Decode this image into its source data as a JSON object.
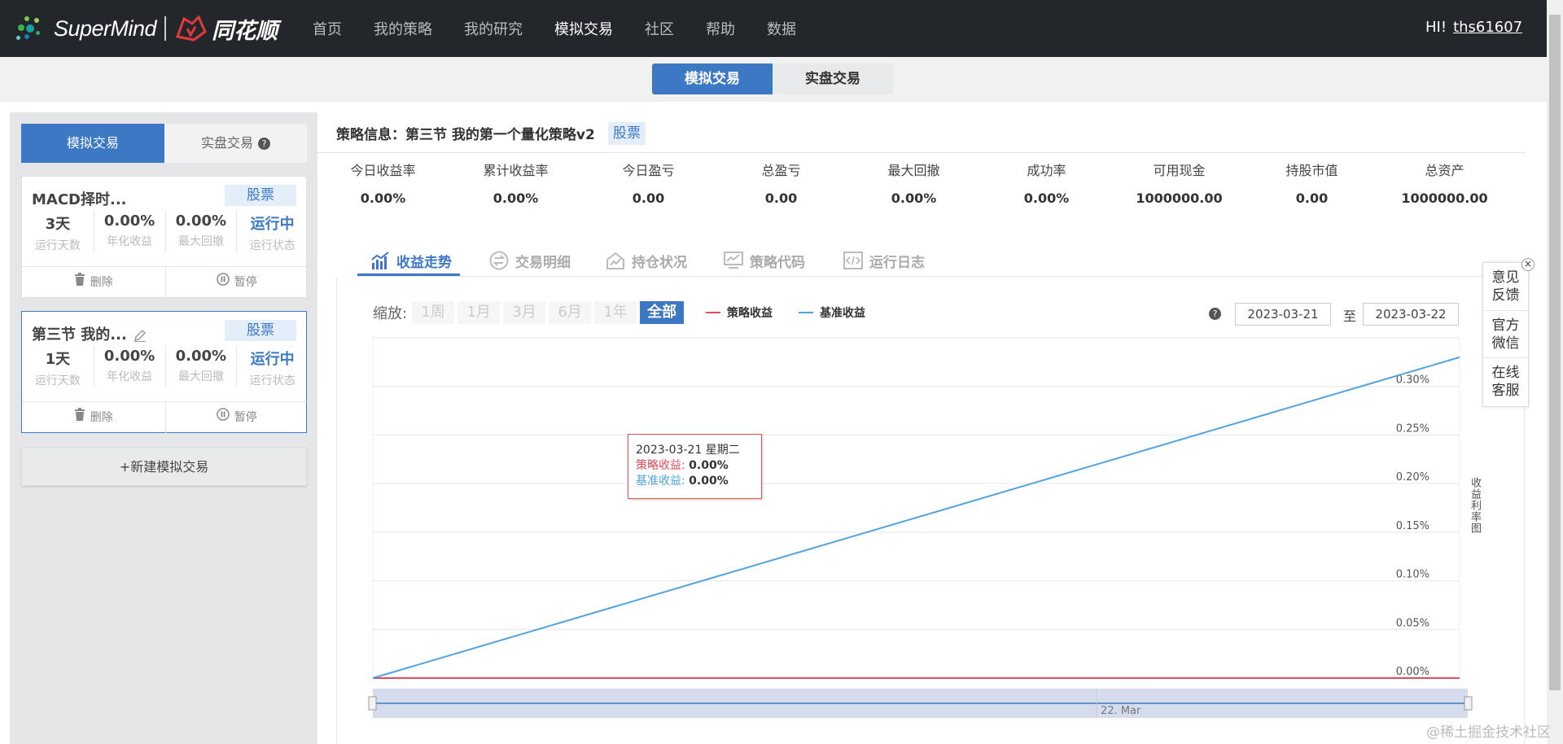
{
  "brand": {
    "supermind": "SuperMind",
    "ths": "同花顺"
  },
  "nav": {
    "items": [
      "首页",
      "我的策略",
      "我的研究",
      "模拟交易",
      "社区",
      "帮助",
      "数据"
    ],
    "active_index": 3,
    "greeting": "HI!",
    "username": "ths61607"
  },
  "subtabs": {
    "sim": "模拟交易",
    "real": "实盘交易"
  },
  "left": {
    "tab_sim": "模拟交易",
    "tab_real": "实盘交易",
    "help": "?",
    "cards": [
      {
        "title": "MACD择时...",
        "tag": "股票",
        "stats": [
          {
            "value": "3天",
            "label": "运行天数"
          },
          {
            "value": "0.00%",
            "label": "年化收益"
          },
          {
            "value": "0.00%",
            "label": "最大回撤"
          },
          {
            "value": "运行中",
            "label": "运行状态"
          }
        ],
        "delete": "删除",
        "pause": "暂停"
      },
      {
        "title": "第三节 我的...",
        "tag": "股票",
        "stats": [
          {
            "value": "1天",
            "label": "运行天数"
          },
          {
            "value": "0.00%",
            "label": "年化收益"
          },
          {
            "value": "0.00%",
            "label": "最大回撤"
          },
          {
            "value": "运行中",
            "label": "运行状态"
          }
        ],
        "delete": "删除",
        "pause": "暂停"
      }
    ],
    "new_button": "+新建模拟交易"
  },
  "strategy": {
    "title": "策略信息：第三节 我的第一个量化策略v2",
    "tag": "股票",
    "metrics": [
      {
        "label": "今日收益率",
        "value": "0.00%"
      },
      {
        "label": "累计收益率",
        "value": "0.00%"
      },
      {
        "label": "今日盈亏",
        "value": "0.00"
      },
      {
        "label": "总盈亏",
        "value": "0.00"
      },
      {
        "label": "最大回撤",
        "value": "0.00%"
      },
      {
        "label": "成功率",
        "value": "0.00%"
      },
      {
        "label": "可用现金",
        "value": "1000000.00"
      },
      {
        "label": "持股市值",
        "value": "0.00"
      },
      {
        "label": "总资产",
        "value": "1000000.00"
      }
    ]
  },
  "tabs": [
    "收益走势",
    "交易明细",
    "持仓状况",
    "策略代码",
    "运行日志"
  ],
  "controls": {
    "zoom_label": "缩放:",
    "zoom_options": [
      "1周",
      "1月",
      "3月",
      "6月",
      "1年",
      "全部"
    ],
    "zoom_selected": "全部",
    "legend_strategy": "策略收益",
    "legend_benchmark": "基准收益",
    "date_from": "2023-03-21",
    "date_sep": "至",
    "date_to": "2023-03-22",
    "help": "?"
  },
  "tooltip": {
    "date": "2023-03-21 星期二",
    "strategy_label": "策略收益:",
    "strategy_value": "0.00%",
    "benchmark_label": "基准收益:",
    "benchmark_value": "0.00%"
  },
  "chart_data": {
    "type": "line",
    "x": [
      "2023-03-21",
      "2023-03-22"
    ],
    "series": [
      {
        "name": "策略收益",
        "values": [
          0.0,
          0.0
        ],
        "color": "#e04c5a"
      },
      {
        "name": "基准收益",
        "values": [
          0.0,
          0.33
        ],
        "color": "#4fa3e0"
      }
    ],
    "y_ticks": [
      "0.00%",
      "0.05%",
      "0.10%",
      "0.15%",
      "0.20%",
      "0.25%",
      "0.30%"
    ],
    "ylim": [
      0,
      0.35
    ],
    "ylabel": "收益利率图",
    "navigator_label": "22. Mar",
    "grid": true
  },
  "feedback": {
    "items": [
      "意见反馈",
      "官方微信",
      "在线客服"
    ],
    "close": "×"
  },
  "watermark": "@稀土掘金技术社区",
  "colors": {
    "accent": "#3c78c4",
    "nav_bg": "#23272b",
    "strategy": "#e04c5a",
    "benchmark": "#4fa3e0"
  }
}
